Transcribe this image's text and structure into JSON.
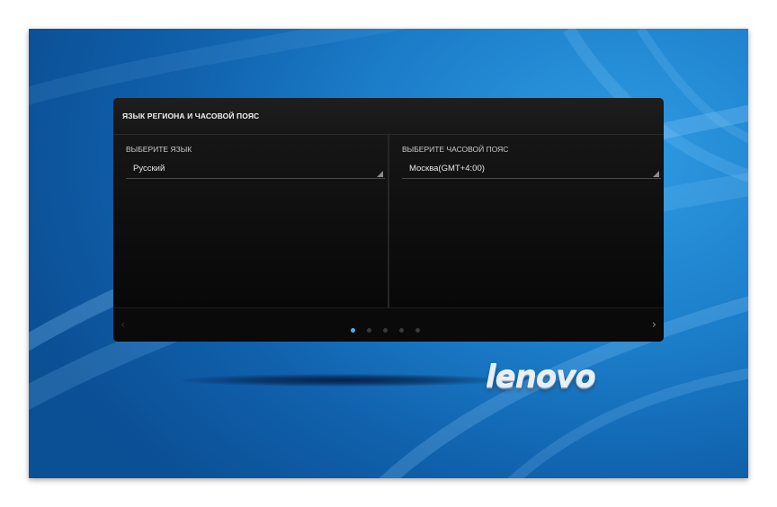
{
  "dialog": {
    "title": "ЯЗЫК РЕГИОНА И ЧАСОВОЙ ПОЯС",
    "language": {
      "label": "ВЫБЕРИТЕ ЯЗЫК",
      "selected": "Русский"
    },
    "timezone": {
      "label": "ВЫБЕРИТЕ ЧАСОВОЙ ПОЯС",
      "selected": "Москва(GMT+4:00)"
    },
    "pager": {
      "prev_icon": "chevron-left-icon",
      "next_icon": "chevron-right-icon",
      "page_count": 5,
      "active_page": 1,
      "active_color": "#49b3e8"
    }
  },
  "brand": {
    "logo_text": "lenovo"
  },
  "colors": {
    "wallpaper": "#1b7cc8",
    "dialog_bg": "#111111"
  }
}
